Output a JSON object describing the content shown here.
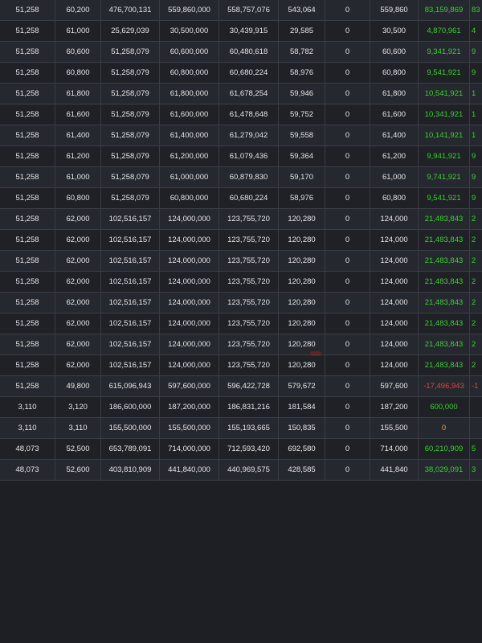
{
  "rows": [
    {
      "c0": "51,258",
      "c1": "60,200",
      "c2": "476,700,131",
      "c3": "559,860,000",
      "c4": "558,757,076",
      "c5": "543,064",
      "c6": "0",
      "c7": "559,860",
      "c8": "83,159,869",
      "c9": "83",
      "c8_class": "pos",
      "c9_class": "pos"
    },
    {
      "c0": "51,258",
      "c1": "61,000",
      "c2": "25,629,039",
      "c3": "30,500,000",
      "c4": "30,439,915",
      "c5": "29,585",
      "c6": "0",
      "c7": "30,500",
      "c8": "4,870,961",
      "c9": "4",
      "c8_class": "pos",
      "c9_class": "pos"
    },
    {
      "c0": "51,258",
      "c1": "60,600",
      "c2": "51,258,079",
      "c3": "60,600,000",
      "c4": "60,480,618",
      "c5": "58,782",
      "c6": "0",
      "c7": "60,600",
      "c8": "9,341,921",
      "c9": "9",
      "c8_class": "pos",
      "c9_class": "pos"
    },
    {
      "c0": "51,258",
      "c1": "60,800",
      "c2": "51,258,079",
      "c3": "60,800,000",
      "c4": "60,680,224",
      "c5": "58,976",
      "c6": "0",
      "c7": "60,800",
      "c8": "9,541,921",
      "c9": "9",
      "c8_class": "pos",
      "c9_class": "pos"
    },
    {
      "c0": "51,258",
      "c1": "61,800",
      "c2": "51,258,079",
      "c3": "61,800,000",
      "c4": "61,678,254",
      "c5": "59,946",
      "c6": "0",
      "c7": "61,800",
      "c8": "10,541,921",
      "c9": "1",
      "c8_class": "pos",
      "c9_class": "pos"
    },
    {
      "c0": "51,258",
      "c1": "61,600",
      "c2": "51,258,079",
      "c3": "61,600,000",
      "c4": "61,478,648",
      "c5": "59,752",
      "c6": "0",
      "c7": "61,600",
      "c8": "10,341,921",
      "c9": "1",
      "c8_class": "pos",
      "c9_class": "pos"
    },
    {
      "c0": "51,258",
      "c1": "61,400",
      "c2": "51,258,079",
      "c3": "61,400,000",
      "c4": "61,279,042",
      "c5": "59,558",
      "c6": "0",
      "c7": "61,400",
      "c8": "10,141,921",
      "c9": "1",
      "c8_class": "pos",
      "c9_class": "pos"
    },
    {
      "c0": "51,258",
      "c1": "61,200",
      "c2": "51,258,079",
      "c3": "61,200,000",
      "c4": "61,079,436",
      "c5": "59,364",
      "c6": "0",
      "c7": "61,200",
      "c8": "9,941,921",
      "c9": "9",
      "c8_class": "pos",
      "c9_class": "pos"
    },
    {
      "c0": "51,258",
      "c1": "61,000",
      "c2": "51,258,079",
      "c3": "61,000,000",
      "c4": "60,879,830",
      "c5": "59,170",
      "c6": "0",
      "c7": "61,000",
      "c8": "9,741,921",
      "c9": "9",
      "c8_class": "pos",
      "c9_class": "pos"
    },
    {
      "c0": "51,258",
      "c1": "60,800",
      "c2": "51,258,079",
      "c3": "60,800,000",
      "c4": "60,680,224",
      "c5": "58,976",
      "c6": "0",
      "c7": "60,800",
      "c8": "9,541,921",
      "c9": "9",
      "c8_class": "pos",
      "c9_class": "pos"
    },
    {
      "c0": "51,258",
      "c1": "62,000",
      "c2": "102,516,157",
      "c3": "124,000,000",
      "c4": "123,755,720",
      "c5": "120,280",
      "c6": "0",
      "c7": "124,000",
      "c8": "21,483,843",
      "c9": "2",
      "c8_class": "pos",
      "c9_class": "pos"
    },
    {
      "c0": "51,258",
      "c1": "62,000",
      "c2": "102,516,157",
      "c3": "124,000,000",
      "c4": "123,755,720",
      "c5": "120,280",
      "c6": "0",
      "c7": "124,000",
      "c8": "21,483,843",
      "c9": "2",
      "c8_class": "pos",
      "c9_class": "pos"
    },
    {
      "c0": "51,258",
      "c1": "62,000",
      "c2": "102,516,157",
      "c3": "124,000,000",
      "c4": "123,755,720",
      "c5": "120,280",
      "c6": "0",
      "c7": "124,000",
      "c8": "21,483,843",
      "c9": "2",
      "c8_class": "pos",
      "c9_class": "pos"
    },
    {
      "c0": "51,258",
      "c1": "62,000",
      "c2": "102,516,157",
      "c3": "124,000,000",
      "c4": "123,755,720",
      "c5": "120,280",
      "c6": "0",
      "c7": "124,000",
      "c8": "21,483,843",
      "c9": "2",
      "c8_class": "pos",
      "c9_class": "pos"
    },
    {
      "c0": "51,258",
      "c1": "62,000",
      "c2": "102,516,157",
      "c3": "124,000,000",
      "c4": "123,755,720",
      "c5": "120,280",
      "c6": "0",
      "c7": "124,000",
      "c8": "21,483,843",
      "c9": "2",
      "c8_class": "pos",
      "c9_class": "pos"
    },
    {
      "c0": "51,258",
      "c1": "62,000",
      "c2": "102,516,157",
      "c3": "124,000,000",
      "c4": "123,755,720",
      "c5": "120,280",
      "c6": "0",
      "c7": "124,000",
      "c8": "21,483,843",
      "c9": "2",
      "c8_class": "pos",
      "c9_class": "pos"
    },
    {
      "c0": "51,258",
      "c1": "62,000",
      "c2": "102,516,157",
      "c3": "124,000,000",
      "c4": "123,755,720",
      "c5": "120,280",
      "c6": "0",
      "c7": "124,000",
      "c8": "21,483,843",
      "c9": "2",
      "c8_class": "pos",
      "c9_class": "pos"
    },
    {
      "c0": "51,258",
      "c1": "62,000",
      "c2": "102,516,157",
      "c3": "124,000,000",
      "c4": "123,755,720",
      "c5": "120,280",
      "c6": "0",
      "c7": "124,000",
      "c8": "21,483,843",
      "c9": "2",
      "c8_class": "pos",
      "c9_class": "pos"
    },
    {
      "c0": "51,258",
      "c1": "49,800",
      "c2": "615,096,943",
      "c3": "597,600,000",
      "c4": "596,422,728",
      "c5": "579,672",
      "c6": "0",
      "c7": "597,600",
      "c8": "-17,496,943",
      "c9": "-1",
      "c8_class": "neg",
      "c9_class": "neg"
    },
    {
      "c0": "3,110",
      "c1": "3,120",
      "c2": "186,600,000",
      "c3": "187,200,000",
      "c4": "186,831,216",
      "c5": "181,584",
      "c6": "0",
      "c7": "187,200",
      "c8": "600,000",
      "c9": "",
      "c8_class": "pos",
      "c9_class": "pos"
    },
    {
      "c0": "3,110",
      "c1": "3,110",
      "c2": "155,500,000",
      "c3": "155,500,000",
      "c4": "155,193,665",
      "c5": "150,835",
      "c6": "0",
      "c7": "155,500",
      "c8": "0",
      "c9": "",
      "c8_class": "zero",
      "c9_class": "zero"
    },
    {
      "c0": "48,073",
      "c1": "52,500",
      "c2": "653,789,091",
      "c3": "714,000,000",
      "c4": "712,593,420",
      "c5": "692,580",
      "c6": "0",
      "c7": "714,000",
      "c8": "60,210,909",
      "c9": "5",
      "c8_class": "pos",
      "c9_class": "pos"
    },
    {
      "c0": "48,073",
      "c1": "52,600",
      "c2": "403,810,909",
      "c3": "441,840,000",
      "c4": "440,969,575",
      "c5": "428,585",
      "c6": "0",
      "c7": "441,840",
      "c8": "38,029,091",
      "c9": "3",
      "c8_class": "pos",
      "c9_class": "pos"
    }
  ]
}
